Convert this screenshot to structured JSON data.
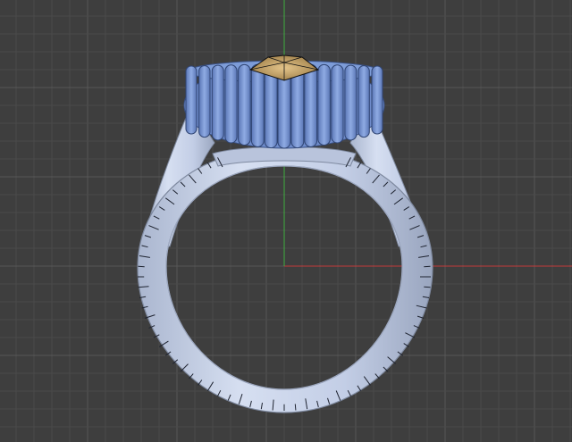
{
  "viewport": {
    "background": "#3e3e3e",
    "grid_minor_color": "#4a4a4a",
    "grid_major_color": "#575757",
    "axis_x_color": "#c23b3b",
    "axis_y_color": "#3fae3f"
  },
  "model": {
    "object": "ring",
    "shank_color": "#c8d3ea",
    "shank_edge_color": "#7f8aa0",
    "setting_color": "#7d9cd8",
    "setting_dark_color": "#4e6aa8",
    "gem_color": "#caa46a",
    "wire_color": "#111111"
  }
}
